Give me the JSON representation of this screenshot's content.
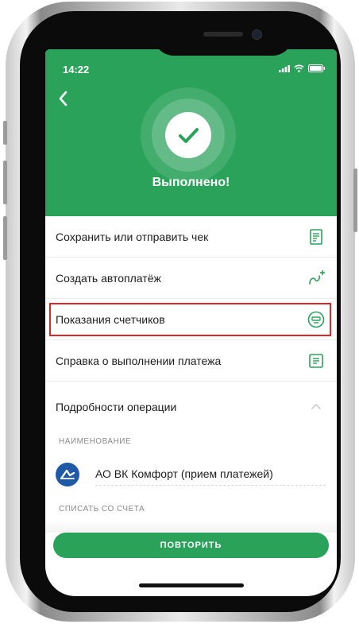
{
  "status_bar": {
    "time": "14:22"
  },
  "header": {
    "title": "Выполнено!"
  },
  "actions": [
    {
      "label": "Сохранить или отправить чек",
      "icon": "receipt-icon"
    },
    {
      "label": "Создать автоплатёж",
      "icon": "autopay-icon"
    },
    {
      "label": "Показания счетчиков",
      "icon": "meter-icon",
      "highlighted": true
    },
    {
      "label": "Справка о выполнении платежа",
      "icon": "document-icon"
    }
  ],
  "details": {
    "title": "Подробности операции",
    "name_caption": "НАИМЕНОВАНИЕ",
    "recipient": "АО ВК Комфорт (прием платежей)",
    "account_caption": "СПИСАТЬ СО СЧЕТА"
  },
  "repeat_button": {
    "label": "ПОВТОРИТЬ"
  },
  "colors": {
    "accent": "#2aa25a",
    "highlight": "#e0262b"
  }
}
